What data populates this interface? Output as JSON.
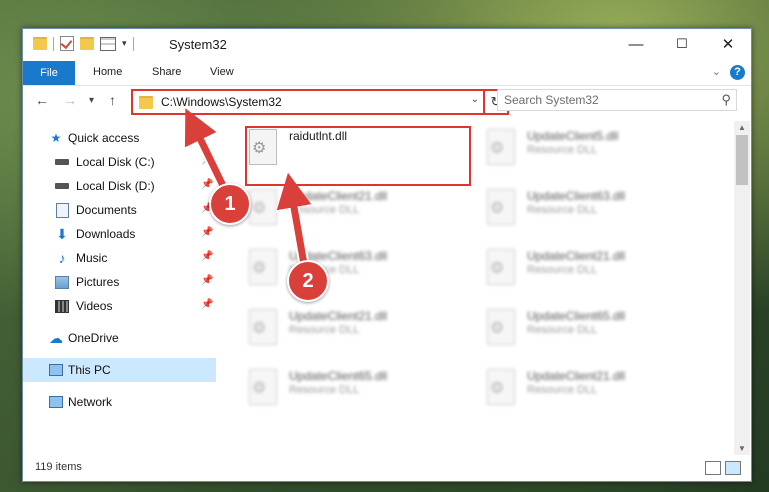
{
  "window": {
    "title": "System32",
    "controls": {
      "minimize": "—",
      "maximize": "☐",
      "close": "✕"
    }
  },
  "ribbon": {
    "tabs": [
      "File",
      "Home",
      "Share",
      "View"
    ]
  },
  "address": {
    "path": "C:\\Windows\\System32",
    "search_placeholder": "Search System32"
  },
  "nav": {
    "items": [
      {
        "label": "Quick access",
        "icon": "star-icon",
        "pinned": false
      },
      {
        "label": "Local Disk (C:)",
        "icon": "drive-icon",
        "pinned": true
      },
      {
        "label": "Local Disk (D:)",
        "icon": "drive-icon",
        "pinned": true
      },
      {
        "label": "Documents",
        "icon": "documents-icon",
        "pinned": true
      },
      {
        "label": "Downloads",
        "icon": "download-icon",
        "pinned": true
      },
      {
        "label": "Music",
        "icon": "music-icon",
        "pinned": true
      },
      {
        "label": "Pictures",
        "icon": "pictures-icon",
        "pinned": true
      },
      {
        "label": "Videos",
        "icon": "videos-icon",
        "pinned": true
      },
      {
        "label": "OneDrive",
        "icon": "cloud-icon",
        "pinned": false
      },
      {
        "label": "This PC",
        "icon": "computer-icon",
        "pinned": false
      },
      {
        "label": "Network",
        "icon": "network-icon",
        "pinned": false
      }
    ]
  },
  "files": [
    {
      "name": "raidutlnt.dll",
      "type": ""
    },
    {
      "name": "UpdateClient5.dll",
      "type": "Resource DLL"
    },
    {
      "name": "UpdateClient21.dll",
      "type": "Resource DLL"
    },
    {
      "name": "UpdateClient63.dll",
      "type": "Resource DLL"
    },
    {
      "name": "UpdateClient63.dll",
      "type": "Resource DLL"
    },
    {
      "name": "UpdateClient21.dll",
      "type": "Resource DLL"
    },
    {
      "name": "UpdateClient21.dll",
      "type": "Resource DLL"
    },
    {
      "name": "UpdateClient65.dll",
      "type": "Resource DLL"
    },
    {
      "name": "UpdateClient65.dll",
      "type": "Resource DLL"
    },
    {
      "name": "UpdateClient21.dll",
      "type": "Resource DLL"
    }
  ],
  "status": {
    "item_count": "119 items"
  },
  "markers": {
    "one": "1",
    "two": "2"
  },
  "colors": {
    "accent": "#1979ca",
    "highlight": "#e0342f",
    "selection": "#cce8ff"
  }
}
